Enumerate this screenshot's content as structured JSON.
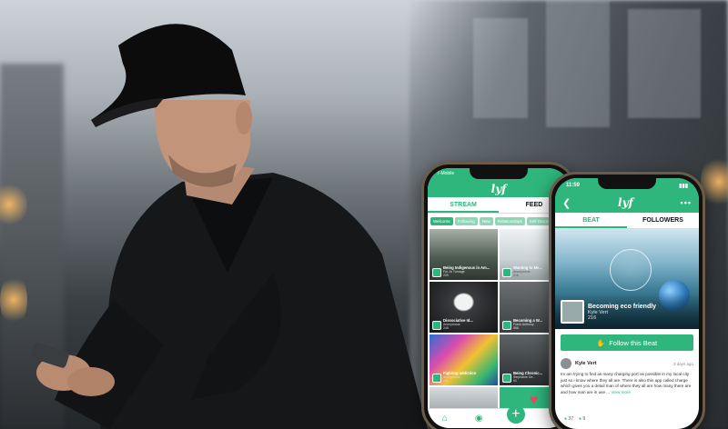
{
  "phone_left": {
    "status_carrier": "T-Mobile",
    "tabs": [
      "STREAM",
      "FEED"
    ],
    "chips": [
      "Welcome",
      "Following",
      "New",
      "Relationships",
      "Self-Discovery"
    ],
    "tiles": [
      {
        "title": "Being Indigenous in Am...",
        "sub": "For Jo Turnage",
        "stats": "209"
      },
      {
        "title": "Wanting to Me...",
        "sub": "Anonymous",
        "stats": "216"
      },
      {
        "title": "Dissociative Id...",
        "sub": "Anonymous",
        "stats": "245"
      },
      {
        "title": "Becoming a W...",
        "sub": "Frank Anthony",
        "stats": "568"
      },
      {
        "title": "Fighting addiction",
        "sub": "Anonymous",
        "stats": "261"
      },
      {
        "title": "Being Chronic...",
        "sub": "Stephanie Ge...",
        "stats": "91"
      }
    ]
  },
  "phone_right": {
    "status_time": "11:59",
    "tabs": [
      "BEAT",
      "FOLLOWERS"
    ],
    "beat_title": "Becoming eco friendly",
    "beat_owner": "Kyle Vert",
    "beat_stats": "216",
    "follow_label": "Follow this Beat",
    "post": {
      "author": "Kyle Vert",
      "time": "3 days ago",
      "body": "Im am trying to find as many charging port as possible in my local city just so i know where they all are. There is also this app called charge which gives you a detail man of where they all are how many there are and how man are in use ...",
      "more": "View more",
      "likes": "37",
      "comments": "9"
    }
  }
}
